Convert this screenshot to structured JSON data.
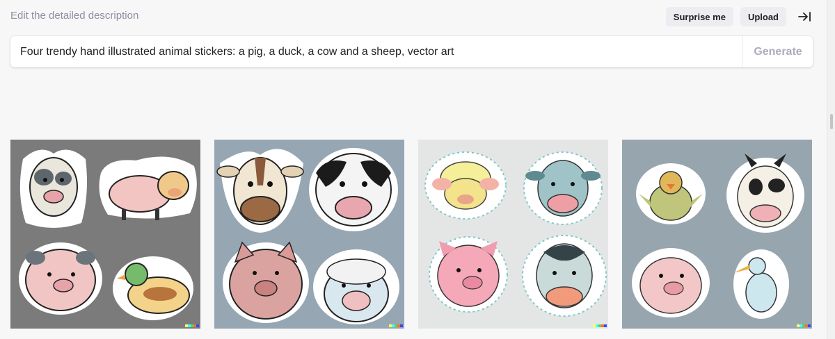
{
  "header": {
    "label": "Edit the detailed description"
  },
  "toolbar": {
    "surprise_label": "Surprise me",
    "upload_label": "Upload",
    "collapse_icon": "collapse-panel-icon"
  },
  "prompt": {
    "text": "Four trendy hand illustrated animal stickers: a pig, a duck, a cow and a sheep, vector art",
    "generate_label": "Generate"
  },
  "results": [
    {
      "bg": "#7b7b7b",
      "stickers": [
        "cow",
        "pig",
        "pig",
        "duck"
      ]
    },
    {
      "bg": "#96a6b3",
      "stickers": [
        "cow",
        "cow",
        "pig",
        "sheep"
      ]
    },
    {
      "bg": "#e4e6e6",
      "stickers": [
        "sheep",
        "cow",
        "pig",
        "cow"
      ]
    },
    {
      "bg": "#97a6ae",
      "stickers": [
        "duck",
        "cow",
        "pig",
        "duck"
      ]
    }
  ],
  "watermark_colors": [
    "#ffff66",
    "#42ffff",
    "#51da4c",
    "#ff6e3c",
    "#3c46ff"
  ]
}
